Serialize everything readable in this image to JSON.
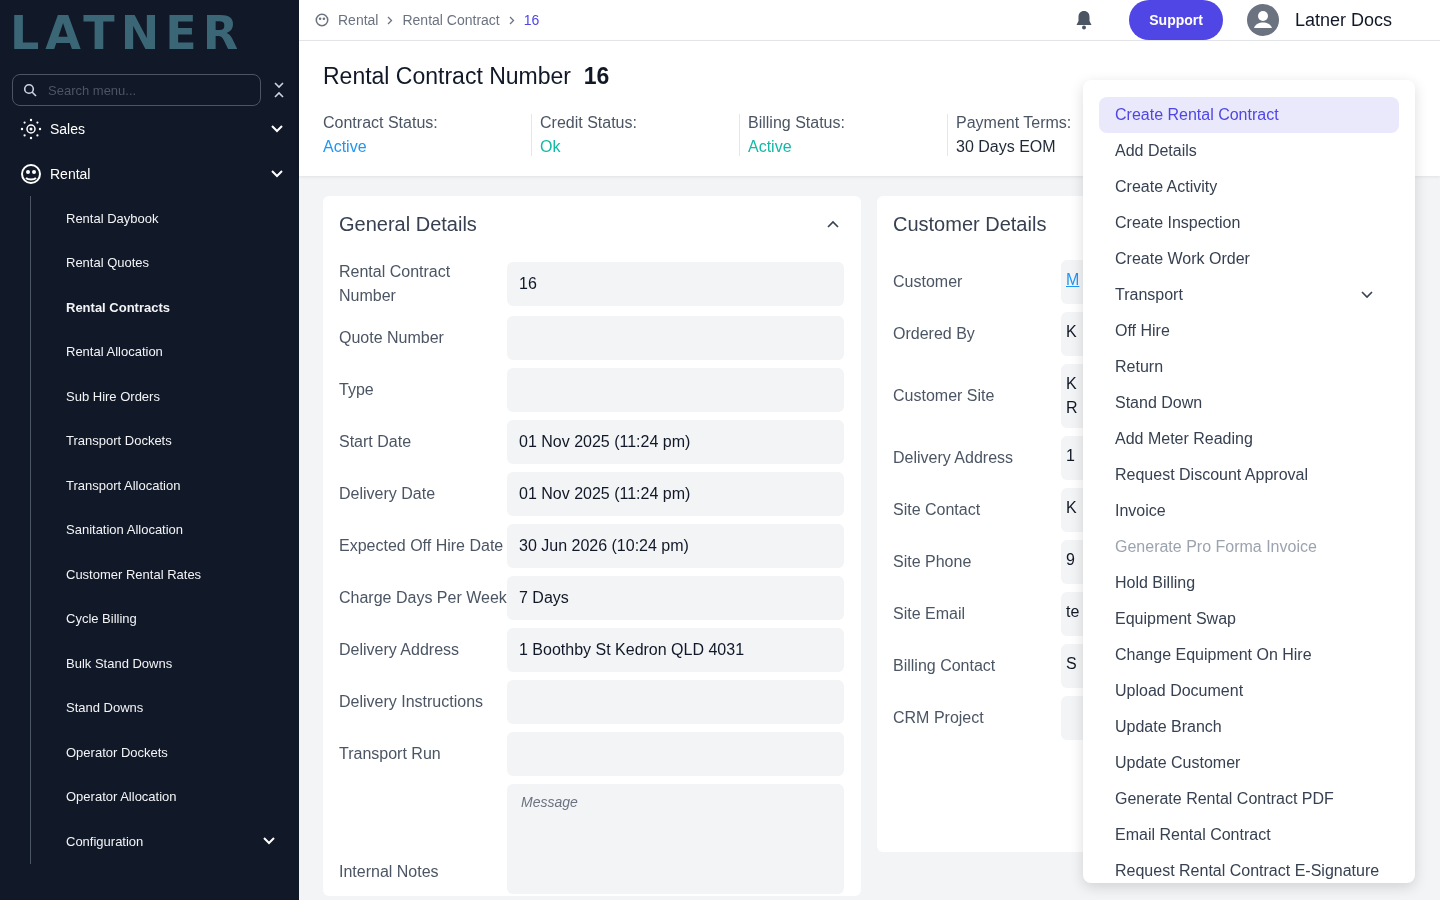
{
  "logo": "LATNER",
  "sidebar": {
    "search_placeholder": "Search menu...",
    "groups": [
      {
        "label": "Sales"
      },
      {
        "label": "Rental",
        "expanded": true,
        "children": [
          {
            "label": "Rental Daybook",
            "selected": false
          },
          {
            "label": "Rental Quotes",
            "selected": false
          },
          {
            "label": "Rental Contracts",
            "selected": true
          },
          {
            "label": "Rental Allocation",
            "selected": false
          },
          {
            "label": "Sub Hire Orders",
            "selected": false
          },
          {
            "label": "Transport Dockets",
            "selected": false
          },
          {
            "label": "Transport Allocation",
            "selected": false
          },
          {
            "label": "Sanitation Allocation",
            "selected": false
          },
          {
            "label": "Customer Rental Rates",
            "selected": false
          },
          {
            "label": "Cycle Billing",
            "selected": false
          },
          {
            "label": "Bulk Stand Downs",
            "selected": false
          },
          {
            "label": "Stand Downs",
            "selected": false
          },
          {
            "label": "Operator Dockets",
            "selected": false
          },
          {
            "label": "Operator Allocation",
            "selected": false
          },
          {
            "label": "Configuration",
            "selected": false,
            "has_children": true
          }
        ]
      }
    ]
  },
  "breadcrumb": [
    "Rental",
    "Rental Contract",
    "16"
  ],
  "header": {
    "support": "Support",
    "user": "Latner Docs"
  },
  "title": {
    "label": "Rental Contract Number",
    "number": "16"
  },
  "statuses": [
    {
      "label": "Contract Status:",
      "value": "Active",
      "color": "#2196f3"
    },
    {
      "label": "Credit Status:",
      "value": "Ok",
      "color": "#14b8a6"
    },
    {
      "label": "Billing Status:",
      "value": "Active",
      "color": "#14b8a6"
    },
    {
      "label": "Payment Terms:",
      "value": "30 Days EOM",
      "color": "#1f2937"
    }
  ],
  "general": {
    "title": "General Details",
    "expanded": true,
    "rows": [
      {
        "label": "Rental Contract Number",
        "value": "16"
      },
      {
        "label": "Quote Number"
      },
      {
        "label": "Type"
      },
      {
        "label": "Start Date",
        "value": "01 Nov 2025 (11:24 pm)"
      },
      {
        "label": "Delivery Date",
        "value": "01 Nov 2025 (11:24 pm)"
      },
      {
        "label": "Expected Off Hire Date",
        "value": "30 Jun 2026 (10:24 pm)"
      },
      {
        "label": "Charge Days Per Week",
        "value": "7 Days"
      },
      {
        "label": "Delivery Address",
        "value": "1 Boothby St Kedron QLD 4031"
      },
      {
        "label": "Delivery Instructions"
      },
      {
        "label": "Transport Run"
      },
      {
        "label": "Internal Notes",
        "kind": "textarea",
        "placeholder": "Message"
      }
    ]
  },
  "customer": {
    "title": "Customer Details",
    "rows": [
      {
        "label": "Customer",
        "lines": [
          "M"
        ],
        "kind": "link"
      },
      {
        "label": "Ordered By",
        "lines": [
          "K"
        ]
      },
      {
        "label": "Customer Site",
        "lines": [
          "K",
          "R"
        ]
      },
      {
        "label": "Delivery Address",
        "lines": [
          "1"
        ]
      },
      {
        "label": "Site Contact",
        "lines": [
          "K"
        ]
      },
      {
        "label": "Site Phone",
        "lines": [
          "9"
        ]
      },
      {
        "label": "Site Email",
        "lines": [
          "te"
        ]
      },
      {
        "label": "Billing Contact",
        "lines": [
          "S"
        ]
      },
      {
        "label": "CRM Project",
        "lines": []
      }
    ]
  },
  "menu": [
    {
      "label": "Create Rental Contract",
      "selected": true,
      "disabled": false
    },
    {
      "label": "Add Details",
      "selected": false,
      "disabled": false
    },
    {
      "label": "Create Activity",
      "selected": false,
      "disabled": false
    },
    {
      "label": "Create Inspection",
      "selected": false,
      "disabled": false
    },
    {
      "label": "Create Work Order",
      "selected": false,
      "disabled": false
    },
    {
      "label": "Transport",
      "selected": false,
      "disabled": false,
      "has_submenu": true
    },
    {
      "label": "Off Hire",
      "selected": false,
      "disabled": false
    },
    {
      "label": "Return",
      "selected": false,
      "disabled": false
    },
    {
      "label": "Stand Down",
      "selected": false,
      "disabled": false
    },
    {
      "label": "Add Meter Reading",
      "selected": false,
      "disabled": false
    },
    {
      "label": "Request Discount Approval",
      "selected": false,
      "disabled": false
    },
    {
      "label": "Invoice",
      "selected": false,
      "disabled": false
    },
    {
      "label": "Generate Pro Forma Invoice",
      "selected": false,
      "disabled": true
    },
    {
      "label": "Hold Billing",
      "selected": false,
      "disabled": false
    },
    {
      "label": "Equipment Swap",
      "selected": false,
      "disabled": false
    },
    {
      "label": "Change Equipment On Hire",
      "selected": false,
      "disabled": false
    },
    {
      "label": "Upload Document",
      "selected": false,
      "disabled": false
    },
    {
      "label": "Update Branch",
      "selected": false,
      "disabled": false
    },
    {
      "label": "Update Customer",
      "selected": false,
      "disabled": false
    },
    {
      "label": "Generate Rental Contract PDF",
      "selected": false,
      "disabled": false
    },
    {
      "label": "Email Rental Contract",
      "selected": false,
      "disabled": false
    },
    {
      "label": "Request Rental Contract E-Signature",
      "selected": false,
      "disabled": false
    }
  ]
}
